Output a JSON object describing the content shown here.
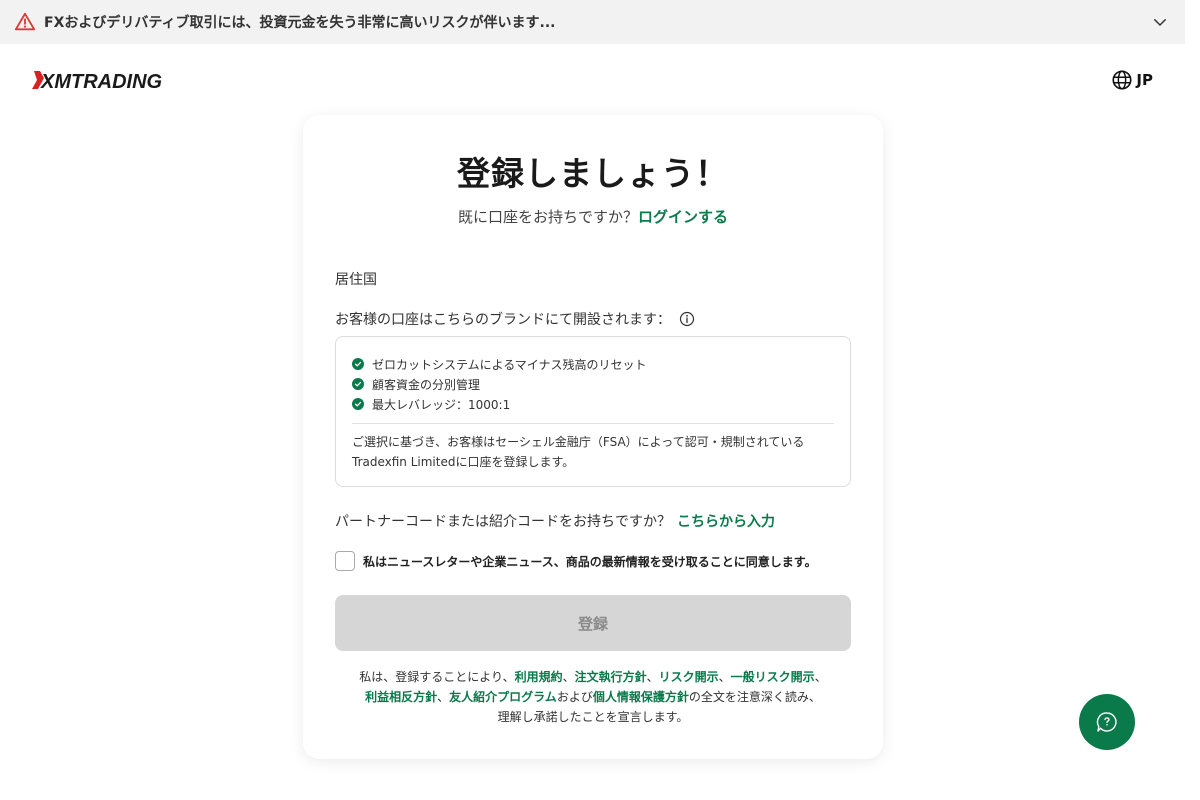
{
  "risk_bar": {
    "text": "FXおよびデリバティブ取引には、投資元金を失う非常に高いリスクが伴います...",
    "icon": "warning-triangle-icon",
    "color": "#d93a3a"
  },
  "header": {
    "logo_text": "XMTRADING",
    "language": "JP"
  },
  "card": {
    "title": "登録しましょう！",
    "subtitle_text": "既に口座をお持ちですか？",
    "login_link": "ログインする",
    "country_label": "居住国",
    "brand_label": "お客様の口座はこちらのブランドにて開設されます：",
    "features": [
      "ゼロカットシステムによるマイナス残高のリセット",
      "顧客資金の分別管理",
      "最大レバレッジ：1000:1"
    ],
    "brand_note_line1": "ご選択に基づき、お客様はセーシェル金融庁（FSA）によって認可・規制されている",
    "brand_note_line2": "Tradexfin Limitedに口座を登録します。",
    "partner_text": "パートナーコードまたは紹介コードをお持ちですか？",
    "partner_link": "こちらから入力",
    "newsletter_text": "私はニュースレターや企業ニュース、商品の最新情報を受け取ることに同意します。",
    "submit_label": "登録",
    "terms": {
      "prefix": "私は、登録することにより、",
      "link1": "利用規約",
      "sep1": "、",
      "link2": "注文執行方針",
      "sep2": "、",
      "link3": "リスク開示",
      "sep3": "、",
      "link4": "一般リスク開示",
      "sep4": "、",
      "link5": "利益相反方針",
      "sep5": "、",
      "link6": "友人紹介プログラム",
      "and": "および",
      "link7": "個人情報保護方針",
      "suffix1": "の全文を注意深く読み、",
      "suffix2": "理解し承諾したことを宣言します。"
    }
  },
  "colors": {
    "accent": "#0b7a4b",
    "disabled_button": "#d6d6d6"
  }
}
